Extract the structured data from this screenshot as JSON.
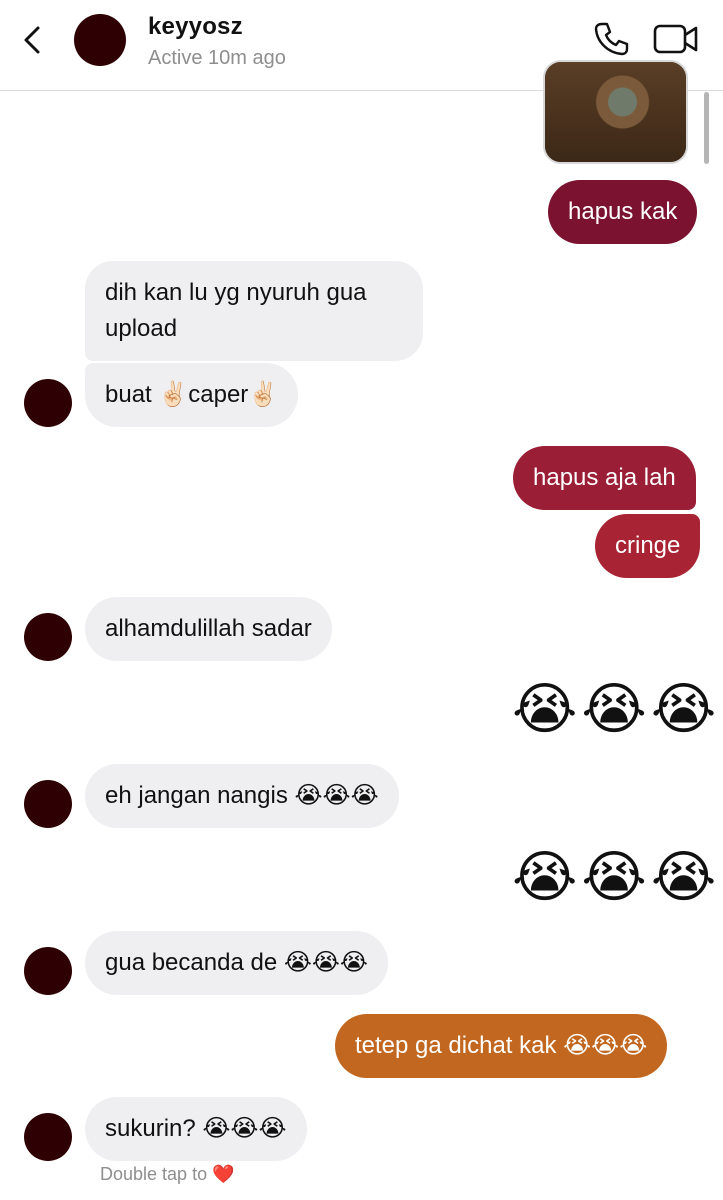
{
  "header": {
    "username": "keyyosz",
    "status": "Active 10m ago"
  },
  "icons": {
    "back": "chevron-left-icon",
    "call": "phone-icon",
    "video": "video-camera-icon"
  },
  "colors": {
    "avatar": "#2e0003",
    "incoming_bubble": "#efeff2",
    "outgoing_1": "#7a1230",
    "outgoing_2": "#a82434",
    "outgoing_3": "#c2671f",
    "heart": "#e0243a"
  },
  "messages": {
    "m1": {
      "text": "hapus kak",
      "from": "me"
    },
    "m2": {
      "text": "dih kan lu yg nyuruh gua upload",
      "from": "them"
    },
    "m3": {
      "text": "buat ✌🏻caper✌🏻",
      "from": "them"
    },
    "m4": {
      "text": "hapus aja lah",
      "from": "me"
    },
    "m5": {
      "text": "cringe",
      "from": "me"
    },
    "m6": {
      "text": "alhamdulillah sadar",
      "from": "them"
    },
    "m7": {
      "text": "😭😭😭",
      "from": "me"
    },
    "m8": {
      "text": "eh jangan nangis 😭😭😭",
      "from": "them"
    },
    "m9": {
      "text": "😭😭😭",
      "from": "me"
    },
    "m10": {
      "text": "gua becanda de 😭😭😭",
      "from": "them"
    },
    "m11": {
      "text": "tetep ga dichat kak 😭😭😭",
      "from": "me"
    },
    "m12": {
      "text": "sukurin? 😭😭😭",
      "from": "them"
    }
  },
  "footer": {
    "double_tap_text": "Double tap to",
    "heart": "❤️"
  }
}
